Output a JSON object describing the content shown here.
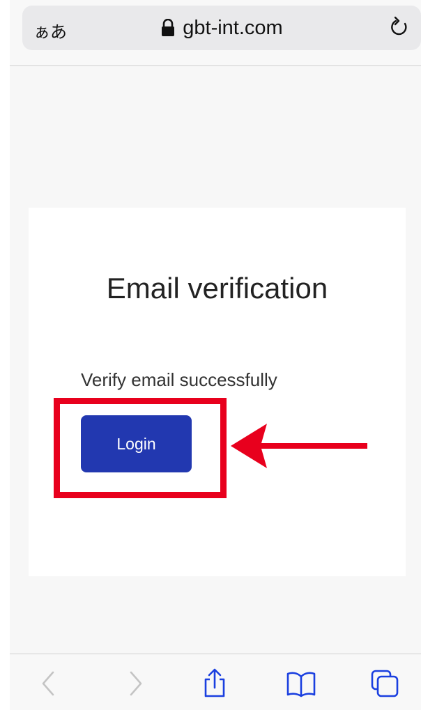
{
  "browser": {
    "text_size_label": "ぁあ",
    "url": "gbt-int.com"
  },
  "card": {
    "title": "Email verification",
    "message": "Verify email successfully",
    "login_label": "Login"
  },
  "toolbar": {
    "icons": [
      "back-icon",
      "forward-icon",
      "share-icon",
      "bookmarks-icon",
      "tabs-icon"
    ]
  },
  "colors": {
    "button": "#2238b0",
    "annotation": "#e8001d"
  }
}
